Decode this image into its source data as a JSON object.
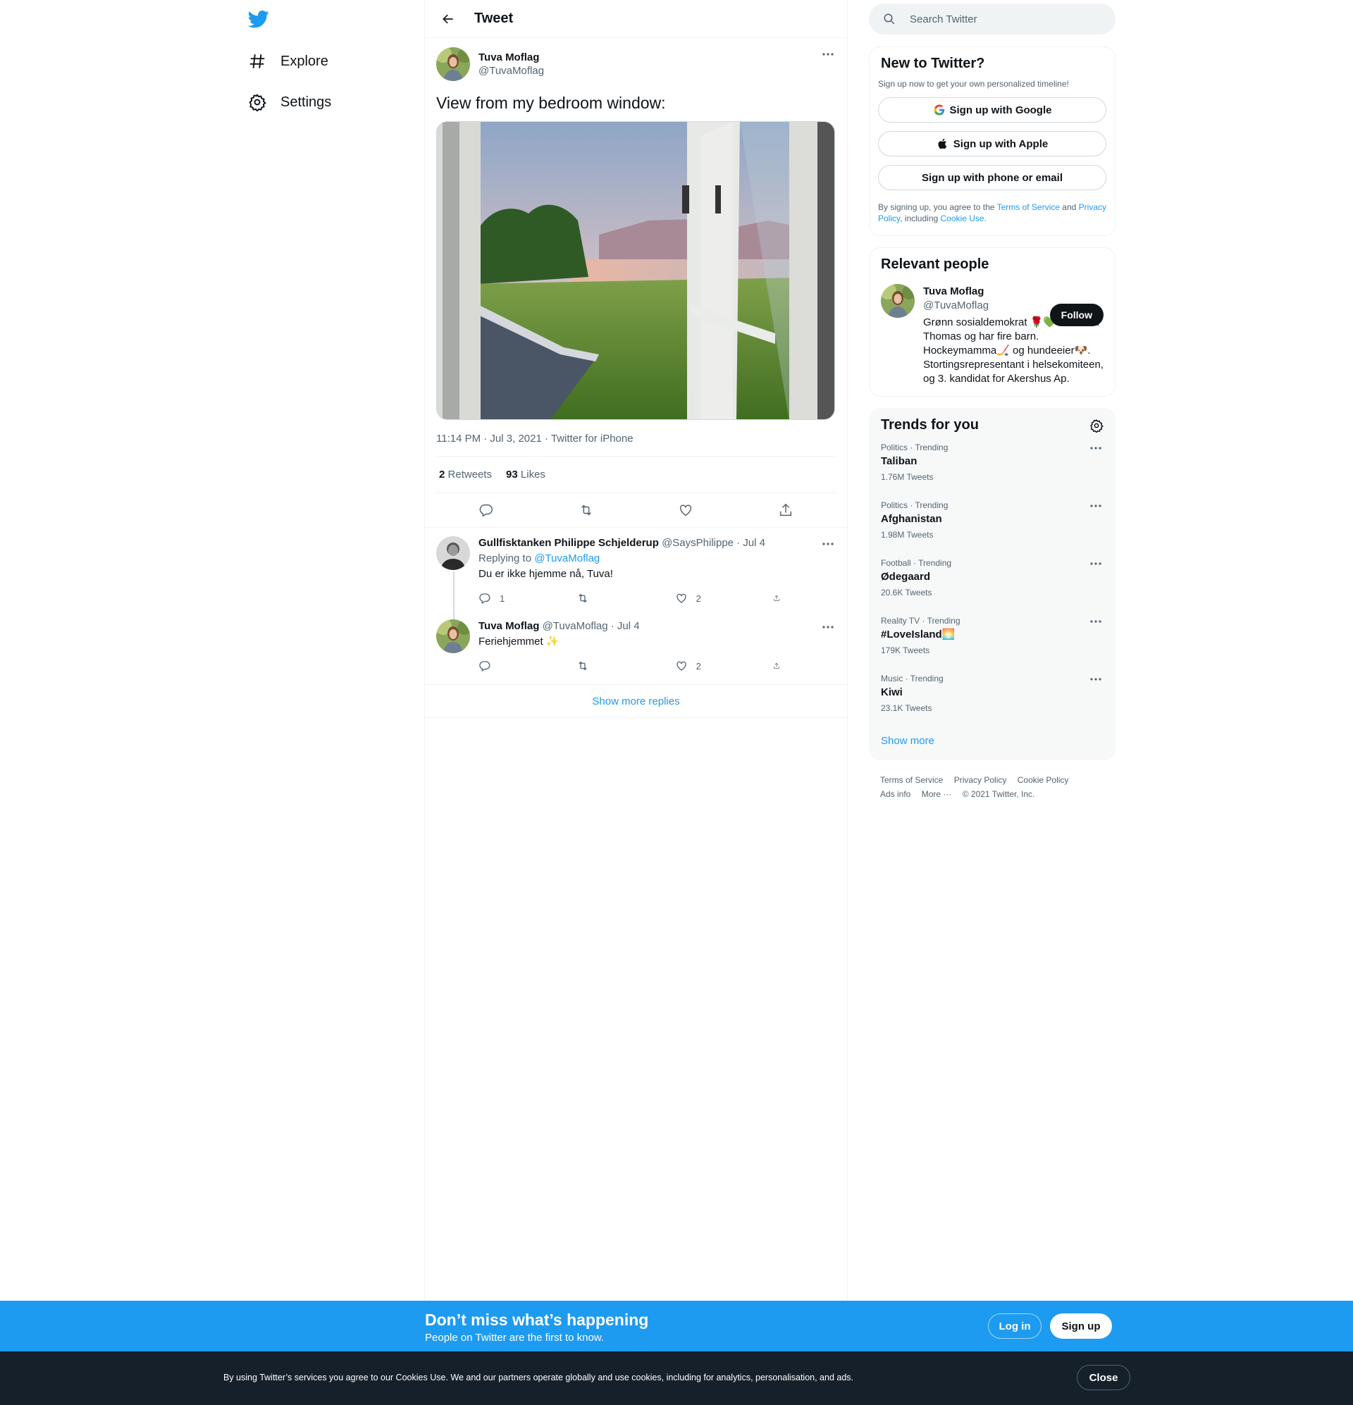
{
  "nav": {
    "explore_label": "Explore",
    "settings_label": "Settings"
  },
  "header": {
    "title": "Tweet"
  },
  "tweet": {
    "name": "Tuva Moflag",
    "handle": "@TuvaMoflag",
    "text": "View from my bedroom window:",
    "meta": "11:14 PM · Jul 3, 2021 · Twitter for iPhone",
    "retweets_count": "2",
    "retweets_label": "Retweets",
    "likes_count": "93",
    "likes_label": "Likes"
  },
  "replies": [
    {
      "name": "Gullfisktanken Philippe Schjelderup",
      "handle_date": "@SaysPhilippe · Jul 4",
      "replying_prefix": "Replying to",
      "replying_handle": "@TuvaMoflag",
      "text": "Du er ikke hjemme nå, Tuva!",
      "reply_count": "1",
      "retweet_count": "",
      "like_count": "2"
    },
    {
      "name": "Tuva Moflag",
      "handle_date": "@TuvaMoflag · Jul 4",
      "text": "Feriehjemmet ✨",
      "reply_count": "",
      "retweet_count": "",
      "like_count": "2"
    }
  ],
  "show_more_replies": "Show more replies",
  "search": {
    "placeholder": "Search Twitter"
  },
  "new_to_twitter": {
    "title": "New to Twitter?",
    "subtitle": "Sign up now to get your own personalized timeline!",
    "google": "Sign up with Google",
    "apple": "Sign up with Apple",
    "phone": "Sign up with phone or email",
    "legal_1": "By signing up, you agree to the",
    "terms": "Terms of Service",
    "legal_2": "and",
    "privacy": "Privacy Policy",
    "legal_3": ", including",
    "cookie": "Cookie Use."
  },
  "relevant": {
    "title": "Relevant people",
    "name": "Tuva Moflag",
    "handle": "@TuvaMoflag",
    "follow": "Follow",
    "bio": "Grønn sosialdemokrat 🌹💚 Gift med Thomas og har fire barn. Hockeymamma🏒 og hundeeier🐶. Stortingsrepresentant i helsekomiteen, og 3. kandidat for Akershus Ap."
  },
  "trends": {
    "title": "Trends for you",
    "items": [
      {
        "category": "Politics · Trending",
        "name": "Taliban",
        "count": "1.76M Tweets"
      },
      {
        "category": "Politics · Trending",
        "name": "Afghanistan",
        "count": "1.98M Tweets"
      },
      {
        "category": "Football · Trending",
        "name": "Ødegaard",
        "count": "20.6K Tweets"
      },
      {
        "category": "Reality TV · Trending",
        "name": "#LoveIsland🌅",
        "count": "179K Tweets"
      },
      {
        "category": "Music · Trending",
        "name": "Kiwi",
        "count": "23.1K Tweets"
      }
    ],
    "show_more": "Show more"
  },
  "footer": {
    "terms": "Terms of Service",
    "privacy": "Privacy Policy",
    "cookie": "Cookie Policy",
    "ads": "Ads info",
    "more": "More ···",
    "copyright": "© 2021 Twitter, Inc."
  },
  "promo": {
    "title": "Don’t miss what’s happening",
    "subtitle": "People on Twitter are the first to know.",
    "login": "Log in",
    "signup": "Sign up"
  },
  "cookie_banner": {
    "text": "By using Twitter’s services you agree to our Cookies Use. We and our partners operate globally and use cookies, including for analytics, personalisation, and ads.",
    "close": "Close"
  },
  "colors": {
    "brand": "#1d9bf0",
    "text": "#0f1419",
    "secondary": "#536471",
    "cookie_bg": "#15202b"
  }
}
